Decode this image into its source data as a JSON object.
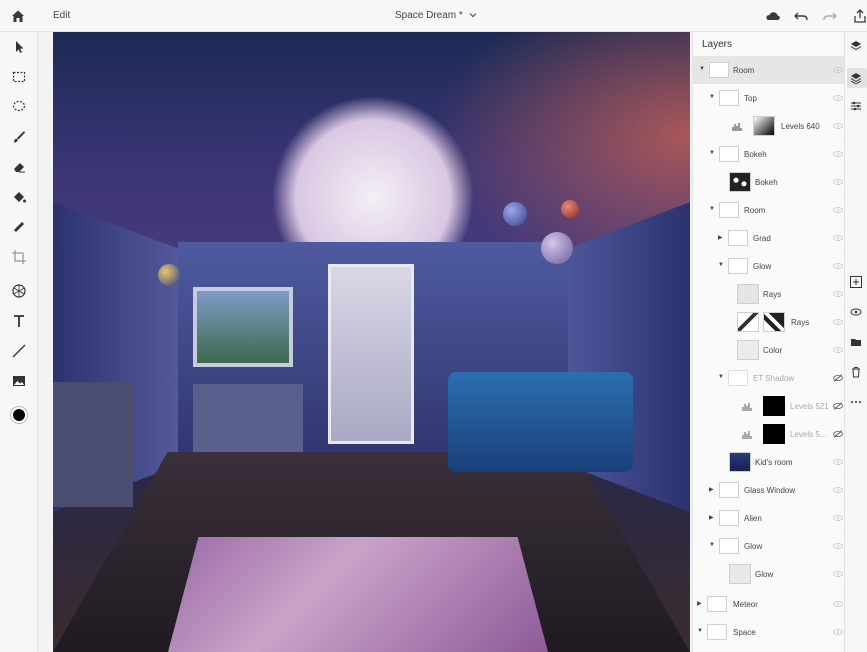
{
  "topbar": {
    "home_icon": "home-icon",
    "edit_label": "Edit",
    "document_title": "Space Dream *",
    "right_icons": [
      "cloud-icon",
      "undo-icon",
      "redo-icon",
      "share-icon"
    ]
  },
  "toolbar": {
    "tools": [
      "select-arrow-icon",
      "marquee-icon",
      "lasso-icon",
      "brush-icon",
      "eraser-icon",
      "fill-bucket-icon",
      "healing-icon",
      "crop-icon",
      "adjustment-icon",
      "type-icon",
      "line-icon",
      "image-place-icon"
    ],
    "foreground_color": "#000000",
    "background_color": "#ffffff"
  },
  "layers": {
    "title": "Layers",
    "rows": [
      {
        "label": "Room",
        "kind": "group",
        "expanded": true,
        "visible": true,
        "selected": true
      },
      {
        "label": "Top",
        "kind": "group",
        "expanded": true,
        "visible": true
      },
      {
        "label": "Levels 640",
        "kind": "adjustment",
        "visible": true
      },
      {
        "label": "Bokeh",
        "kind": "group",
        "expanded": true,
        "visible": true
      },
      {
        "label": "Bokeh",
        "kind": "image",
        "visible": true
      },
      {
        "label": "Room",
        "kind": "group",
        "expanded": true,
        "visible": true
      },
      {
        "label": "Grad",
        "kind": "group",
        "expanded": false,
        "visible": true
      },
      {
        "label": "Glow",
        "kind": "group",
        "expanded": true,
        "visible": true
      },
      {
        "label": "Rays",
        "kind": "fill",
        "visible": true
      },
      {
        "label": "Rays",
        "kind": "masked",
        "visible": true
      },
      {
        "label": "Color",
        "kind": "fill",
        "visible": true
      },
      {
        "label": "ET Shadow",
        "kind": "group",
        "expanded": true,
        "visible": false
      },
      {
        "label": "Levels 521",
        "kind": "adjustment",
        "visible": false
      },
      {
        "label": "Levels 5...",
        "kind": "adjustment",
        "visible": false
      },
      {
        "label": "Kid's room",
        "kind": "image",
        "visible": true
      },
      {
        "label": "Glass Window",
        "kind": "group",
        "expanded": false,
        "visible": true
      },
      {
        "label": "Alien",
        "kind": "group",
        "expanded": false,
        "visible": true
      },
      {
        "label": "Glow",
        "kind": "group",
        "expanded": true,
        "visible": true
      },
      {
        "label": "Glow",
        "kind": "fill",
        "visible": true
      },
      {
        "label": "Meteor",
        "kind": "group",
        "expanded": false,
        "visible": true
      },
      {
        "label": "Space",
        "kind": "group",
        "expanded": true,
        "visible": true
      }
    ]
  },
  "right_strip": {
    "icons": [
      "layers-stack-icon",
      "layers-properties-icon",
      "adjustments-icon",
      "add-layer-icon",
      "visibility-icon",
      "folder-icon",
      "trash-icon",
      "more-icon"
    ]
  }
}
